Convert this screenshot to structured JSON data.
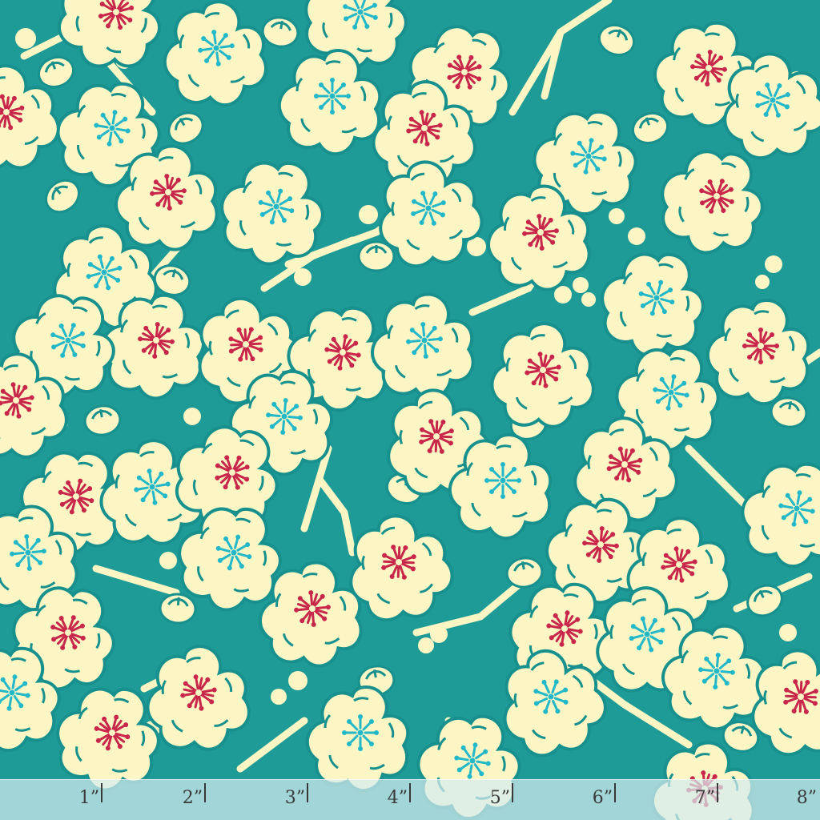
{
  "colors": {
    "background": "#1e9a97",
    "blossom_fill": "#fbf6c4",
    "outline": "#17908e",
    "center_red": "#c8264a",
    "center_teal": "#22b8c9",
    "ruler_bg": "#d6ecf0",
    "ruler_text": "#3a3a3a"
  },
  "pattern": {
    "description_icon": "plum-blossom-icon"
  },
  "ruler": {
    "unit_marks": [
      "1”",
      "2”",
      "3”",
      "4”",
      "5”",
      "6”",
      "7”",
      "8”"
    ]
  }
}
